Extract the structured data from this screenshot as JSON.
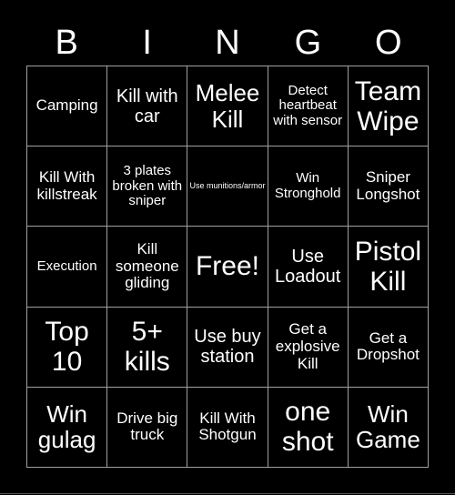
{
  "header": {
    "letters": [
      "B",
      "I",
      "N",
      "G",
      "O"
    ]
  },
  "board": {
    "rows": [
      [
        "Camping",
        "Kill with car",
        "Melee Kill",
        "Detect heartbeat with sensor",
        "Team Wipe"
      ],
      [
        "Kill With killstreak",
        "3 plates broken with sniper",
        "Use munitions/armor",
        "Win Stronghold",
        "Sniper Longshot"
      ],
      [
        "Execution",
        "Kill someone gliding",
        "Free!",
        "Use Loadout",
        "Pistol Kill"
      ],
      [
        "Top 10",
        "5+ kills",
        "Use buy station",
        "Get a explosive Kill",
        "Get a Dropshot"
      ],
      [
        "Win gulag",
        "Drive big truck",
        "Kill With Shotgun",
        "one shot",
        "Win Game"
      ]
    ]
  },
  "colors": {
    "background": "#000000",
    "text": "#ffffff",
    "grid_line": "#a0a0a0"
  }
}
